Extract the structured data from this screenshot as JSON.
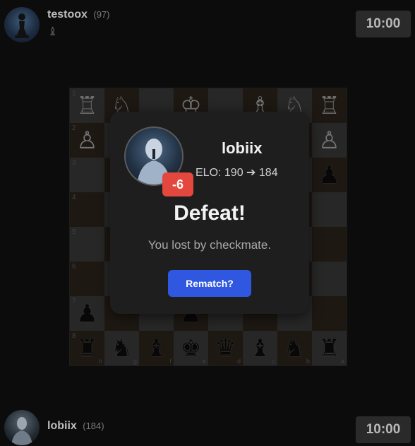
{
  "top_player": {
    "name": "testoox",
    "rating": "(97)",
    "clock": "10:00",
    "captured": "♝"
  },
  "bottom_player": {
    "name": "lobiix",
    "rating": "(184)",
    "clock": "10:00"
  },
  "board": {
    "ranks": [
      "1",
      "2",
      "3",
      "4",
      "5",
      "6",
      "7",
      "8"
    ],
    "files": [
      "h",
      "g",
      "f",
      "e",
      "d",
      "c",
      "b",
      "a"
    ],
    "rows": [
      [
        "♖",
        "♘",
        "",
        "♔",
        "",
        "♗",
        "♘",
        "♖"
      ],
      [
        "♙",
        "",
        "",
        "",
        "",
        "",
        "♙",
        "♙"
      ],
      [
        "",
        "",
        "",
        "",
        "",
        "",
        "",
        "♟"
      ],
      [
        "",
        "",
        "",
        "",
        "",
        "",
        "",
        ""
      ],
      [
        "",
        "",
        "",
        "",
        "",
        "",
        "",
        ""
      ],
      [
        "",
        "",
        "",
        "",
        "",
        "",
        "",
        ""
      ],
      [
        "♟",
        "",
        "",
        "♟",
        "",
        "",
        "",
        ""
      ],
      [
        "♜",
        "♞",
        "♝",
        "♚",
        "♛",
        "♝",
        "♞",
        "♜"
      ]
    ]
  },
  "modal": {
    "name": "lobiix",
    "elo": "ELO: 190 ➔ 184",
    "delta": "-6",
    "result": "Defeat!",
    "reason": "You lost by checkmate.",
    "button": "Rematch?"
  }
}
